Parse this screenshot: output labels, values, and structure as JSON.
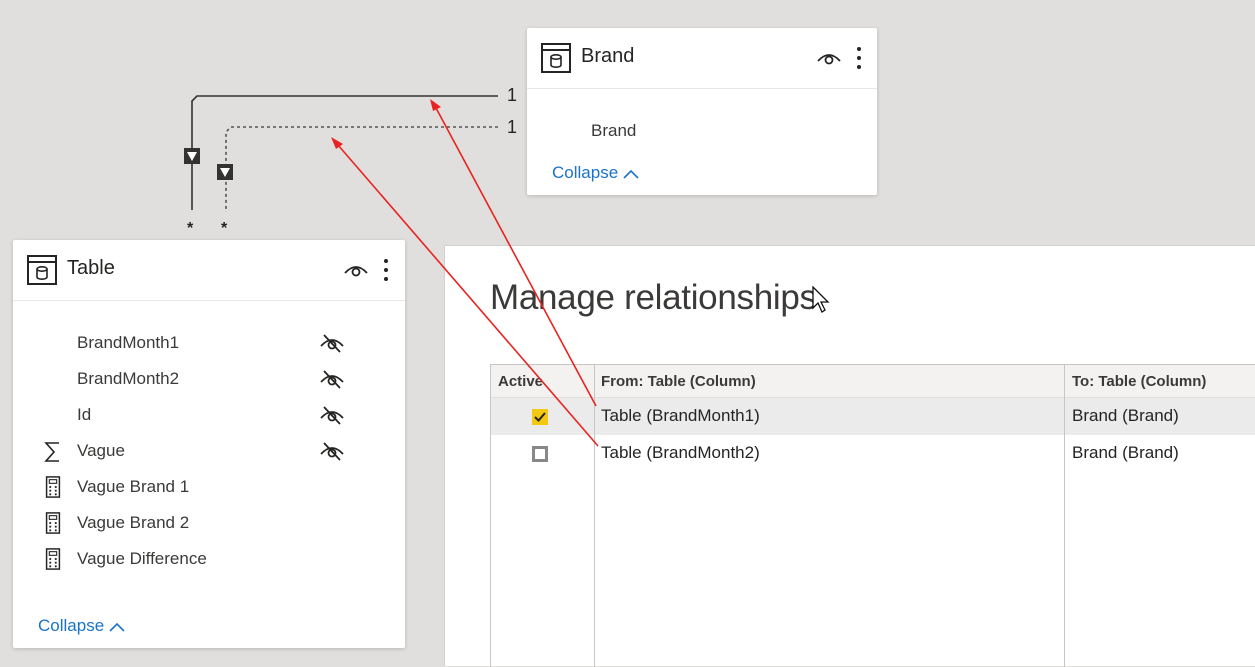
{
  "brand_table": {
    "title": "Brand",
    "fields": [
      {
        "label": "Brand"
      }
    ],
    "collapse_label": "Collapse"
  },
  "main_table": {
    "title": "Table",
    "fields": [
      {
        "label": "BrandMonth1",
        "icon": "none",
        "hidden": true
      },
      {
        "label": "BrandMonth2",
        "icon": "none",
        "hidden": true
      },
      {
        "label": "Id",
        "icon": "none",
        "hidden": true
      },
      {
        "label": "Vague",
        "icon": "sigma-icon",
        "hidden": true
      },
      {
        "label": "Vague Brand 1",
        "icon": "calculator-icon",
        "hidden": false
      },
      {
        "label": "Vague Brand 2",
        "icon": "calculator-icon",
        "hidden": false
      },
      {
        "label": "Vague Difference",
        "icon": "calculator-icon",
        "hidden": false
      }
    ],
    "collapse_label": "Collapse"
  },
  "relationships": {
    "active": {
      "one_label": "1",
      "many_label": "*"
    },
    "inactive": {
      "one_label": "1",
      "many_label": "*"
    }
  },
  "dialog": {
    "title": "Manage relationships",
    "columns": {
      "active": "Active",
      "from": "From: Table (Column)",
      "to": "To: Table (Column)"
    },
    "rows": [
      {
        "active": true,
        "from": "Table (BrandMonth1)",
        "to": "Brand (Brand)"
      },
      {
        "active": false,
        "from": "Table (BrandMonth2)",
        "to": "Brand (Brand)"
      }
    ]
  },
  "colors": {
    "accent_link": "#1a73c7",
    "checkbox_active": "#f2c811",
    "annotation_arrow": "#e8231f"
  }
}
